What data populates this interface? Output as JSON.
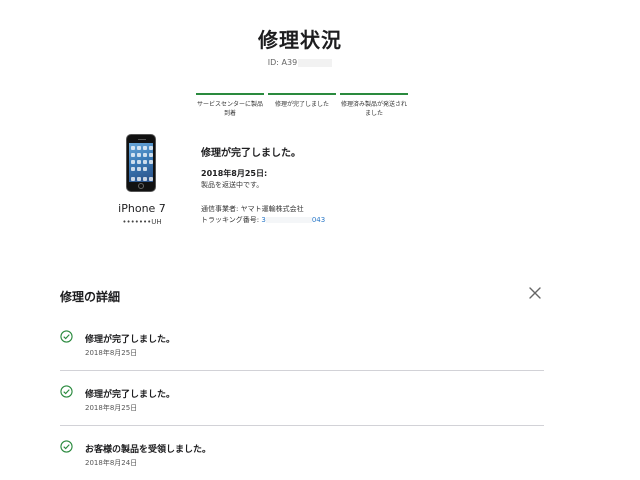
{
  "header": {
    "title": "修理状況",
    "id_label": "ID: A39"
  },
  "progress": {
    "steps": [
      {
        "label": "サービスセンターに製品到着"
      },
      {
        "label": "修理が完了しました"
      },
      {
        "label": "修理済み製品が発送されました"
      }
    ],
    "accent_color": "#2a8a3e"
  },
  "device": {
    "name": "iPhone 7",
    "serial": "•••••••UH"
  },
  "status": {
    "title": "修理が完了しました。",
    "date": "2018年8月25日:",
    "description": "製品を返送中です。",
    "carrier_label": "通信事業者: ",
    "carrier_name": "ヤマト運輸株式会社",
    "tracking_label": "トラッキング番号: ",
    "tracking_prefix": "3",
    "tracking_suffix": "043"
  },
  "details": {
    "title": "修理の詳細",
    "close_icon": "close-icon",
    "items": [
      {
        "title": "修理が完了しました。",
        "date": "2018年8月25日"
      },
      {
        "title": "修理が完了しました。",
        "date": "2018年8月25日"
      },
      {
        "title": "お客様の製品を受領しました。",
        "date": "2018年8月24日"
      }
    ]
  }
}
